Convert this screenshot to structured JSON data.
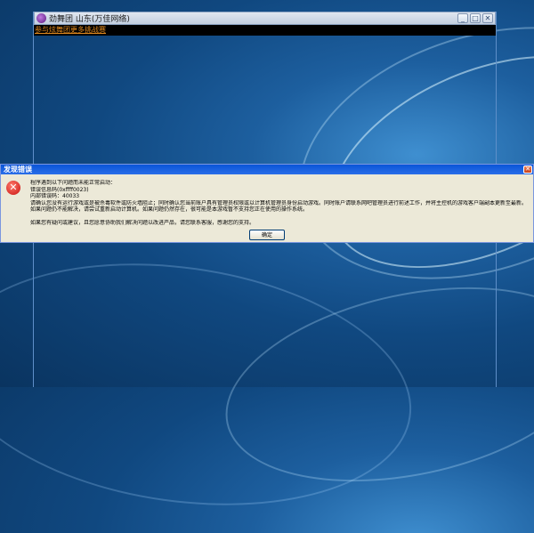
{
  "game_window": {
    "title": "劲舞团  山东(万佳网络)",
    "link_text": "参与炫舞团更多挑战赛",
    "buttons": {
      "minimize": "_",
      "maximize": "□",
      "close": "✕"
    }
  },
  "dialog": {
    "title": "发现错误",
    "close_glyph": "✕",
    "icon_glyph": "✕",
    "lines": [
      "程序遇到以下问题而未能正常启动：",
      "错误信息码(0xffff0023)",
      "内部错误码：40033",
      "请确认您没有运行游戏或是被杀毒软件或防火墙阻止；同时确认您当前账户具有管理员权限或以计算机管理员身份启动游戏。同时账户请联系网吧管理员进行前述工作，并将主控机的游戏客户端副本更新至最新。如果问题仍不能解决，请尝试重新启动计算机。如果问题仍然存在，很可能是本游戏暂不支持您正在使用的操作系统。",
      "如果您有疑问或建议，且您愿意协助我们解决问题以改进产品，请您联系客服，感谢您的支持。"
    ],
    "ok_label": "确定"
  }
}
